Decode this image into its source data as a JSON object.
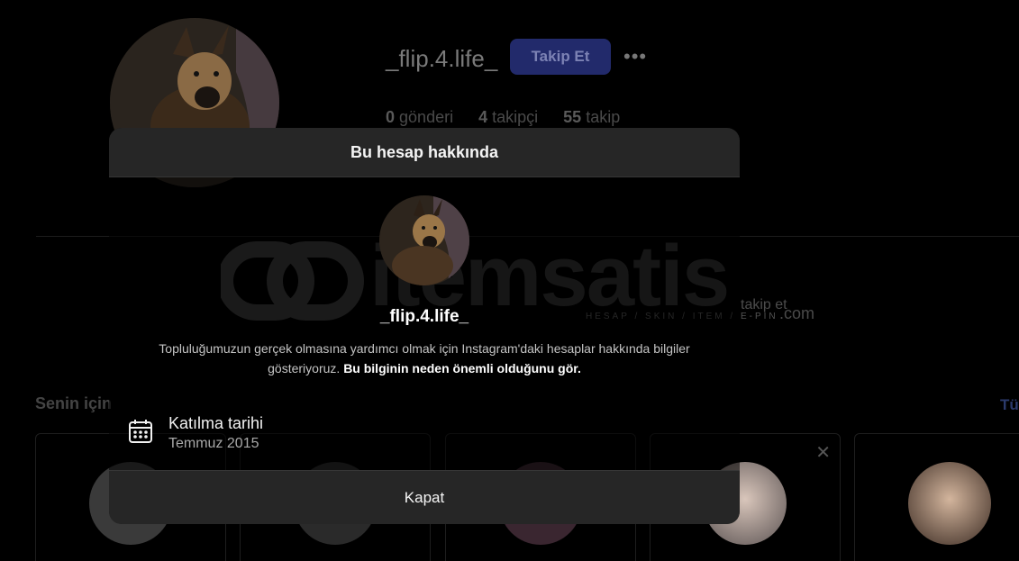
{
  "profile": {
    "username": "_flip.4.life_",
    "follow_label": "Takip Et",
    "more_label": "•••",
    "posts_count": "0",
    "posts_label": "gönderi",
    "followers_count": "4",
    "followers_label": "takipçi",
    "following_count": "55",
    "following_label": "takip"
  },
  "suggestions": {
    "title": "Senin için",
    "see_all": "Tü",
    "follow_label": "takip et"
  },
  "watermark": {
    "text": "itemsatis",
    "sub": "HESAP / SKIN / ITEM / E-PIN",
    "com": ".com"
  },
  "modal": {
    "title": "Bu hesap hakkında",
    "username": "_flip.4.life_",
    "description": "Topluluğumuzun gerçek olmasına yardımcı olmak için Instagram'daki hesaplar hakkında bilgiler gösteriyoruz.",
    "learn_more": "Bu bilginin neden önemli olduğunu gör.",
    "joined_label": "Katılma tarihi",
    "joined_value": "Temmuz 2015",
    "close_label": "Kapat"
  }
}
